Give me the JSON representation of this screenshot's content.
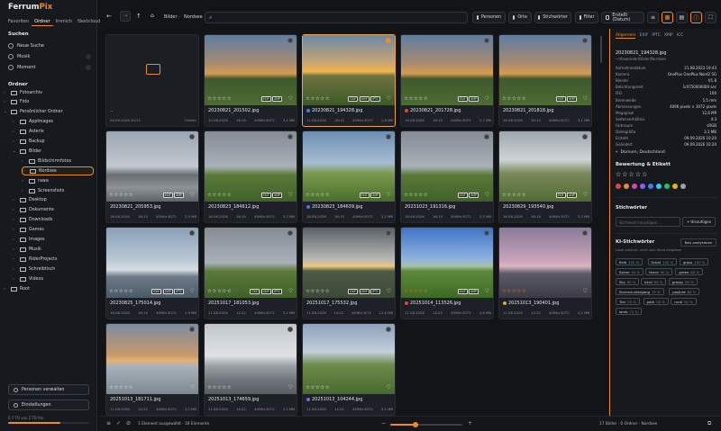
{
  "app": {
    "name_a": "Ferrum",
    "name_b": "Pix"
  },
  "left": {
    "tabs": [
      "Favoriten",
      "Ordner",
      "Immich",
      "Nextcloud"
    ],
    "search_title": "Suchen",
    "searches": [
      "Neue Suche",
      "Musik",
      "Moment"
    ],
    "folders_title": "Ordner",
    "tree": [
      {
        "label": "Fotoarchiv",
        "indent": 1,
        "expanded": false
      },
      {
        "label": "Foto",
        "indent": 1,
        "expanded": false
      },
      {
        "label": "Persönlicher Ordner",
        "indent": 1,
        "expanded": true
      },
      {
        "label": "AppImages",
        "indent": 2,
        "expanded": false
      },
      {
        "label": "Asterix",
        "indent": 2,
        "expanded": false
      },
      {
        "label": "Backup",
        "indent": 2,
        "expanded": false
      },
      {
        "label": "Bilder",
        "indent": 2,
        "expanded": true
      },
      {
        "label": "Bildschirmfotos",
        "indent": 3,
        "expanded": false
      },
      {
        "label": "Nordsee",
        "indent": 3,
        "expanded": false,
        "selected": true
      },
      {
        "label": "rawa",
        "indent": 3,
        "expanded": false
      },
      {
        "label": "Screenshots",
        "indent": 3,
        "expanded": false
      },
      {
        "label": "Desktop",
        "indent": 2,
        "expanded": false
      },
      {
        "label": "Dokumente",
        "indent": 2,
        "expanded": false
      },
      {
        "label": "Downloads",
        "indent": 2,
        "expanded": false
      },
      {
        "label": "Games",
        "indent": 2,
        "expanded": false
      },
      {
        "label": "Images",
        "indent": 2,
        "expanded": false
      },
      {
        "label": "Musik",
        "indent": 2,
        "expanded": false
      },
      {
        "label": "RiderProjects",
        "indent": 2,
        "expanded": false
      },
      {
        "label": "Schreibtisch",
        "indent": 2,
        "expanded": false
      },
      {
        "label": "Videos",
        "indent": 2,
        "expanded": false
      },
      {
        "label": "Root",
        "indent": 1,
        "expanded": false
      }
    ],
    "btn_persons": "Personen verwalten",
    "btn_settings": "Einstellungen",
    "version": "0.7 TB von 2 TB frei",
    "storage_fill": 0.64
  },
  "toolbar": {
    "crumbs": [
      "Bilder",
      "Nordsee"
    ],
    "search_placeholder": "",
    "btn_persons": "Personen",
    "btn_places": "Orte",
    "btn_keywords": "Stichwörter",
    "btn_filter": "Filter",
    "btn_sort": "Erstellt (Datum)"
  },
  "cards": [
    {
      "type": "folder",
      "name": "..",
      "date": "04.09.2026 10:22",
      "kind": "Ordner"
    },
    {
      "name": "20230821_201502.jpg",
      "date": "10.08.2026",
      "time": "16:15",
      "res": "4096×3072",
      "size": "3,1 MB",
      "colorDot": "",
      "thumb": "sunset-field",
      "badges": [
        "EXIF",
        "XMP"
      ]
    },
    {
      "name": "20230821_194328.jpg",
      "date": "11.08.2026",
      "time": "16:15",
      "res": "4096×3072",
      "size": "1,8 MB",
      "colorDot": "#4a7be0",
      "thumb": "sunset-gold",
      "badges": [
        "EXIF",
        "XMP",
        "IPTC"
      ],
      "selected": true
    },
    {
      "name": "20230821_201728.jpg",
      "date": "16.08.2026",
      "time": "16:15",
      "res": "4096×3072",
      "size": "2,7 MB",
      "colorDot": "#e0473b",
      "thumb": "sunset-field",
      "badges": [
        "EXIF",
        "XMP"
      ]
    },
    {
      "name": "20230821_201818.jpg",
      "date": "16.08.2026",
      "time": "16:15",
      "res": "4096×3072",
      "size": "3,1 MB",
      "colorDot": "",
      "thumb": "sunset-field",
      "badges": [
        "EXIF",
        "XMP"
      ]
    },
    {
      "name": "20230821_205953.jpg",
      "date": "16.08.2026",
      "time": "16:15",
      "res": "4096×3072",
      "size": "2,5 MB",
      "colorDot": "",
      "thumb": "beach-grey",
      "badges": [
        "EXIF",
        "XMP"
      ]
    },
    {
      "name": "20230823_184612.jpg",
      "date": "16.08.2026",
      "time": "16:15",
      "res": "4096×3072",
      "size": "3,2 MB",
      "colorDot": "",
      "thumb": "grey-field",
      "badges": [
        "EXIF",
        "XMP"
      ]
    },
    {
      "name": "20230823_184639.jpg",
      "date": "16.08.2026",
      "time": "16:15",
      "res": "4096×3072",
      "size": "3,2 MB",
      "colorDot": "#4a7be0",
      "thumb": "sky-field",
      "badges": [
        "EXIF",
        "XMP"
      ]
    },
    {
      "name": "20231023_191316.jpg",
      "date": "16.08.2026",
      "time": "16:15",
      "res": "4096×3072",
      "size": "2,5 MB",
      "colorDot": "",
      "thumb": "grey-field",
      "badges": [
        "EXIF",
        "XMP"
      ]
    },
    {
      "name": "20230829_193540.jpg",
      "date": "16.08.2026",
      "time": "16:15",
      "res": "4096×3072",
      "size": "3,2 MB",
      "colorDot": "",
      "thumb": "cloud-field",
      "badges": [
        "EXIF",
        "XMP"
      ]
    },
    {
      "name": "20230825_175014.jpg",
      "date": "16.08.2026",
      "time": "16:15",
      "res": "4096×3072",
      "size": "1,9 MB",
      "colorDot": "",
      "thumb": "harbor",
      "badges": [
        "EXIF",
        "XMP",
        "IPTC"
      ]
    },
    {
      "name": "20251017_181053.jpg",
      "date": "11.08.2026",
      "time": "14:22",
      "res": "4096×3072",
      "size": "3,2 MB",
      "colorDot": "",
      "thumb": "grey-field",
      "badges": [
        "EXIF",
        "XMP",
        "IPTC"
      ]
    },
    {
      "name": "20251017_175532.jpg",
      "date": "11.08.2026",
      "time": "14:22",
      "res": "4096×3072",
      "size": "12,6 MB",
      "colorDot": "",
      "thumb": "dramatic",
      "badges": [
        "EXIF",
        "XMP",
        "IPTC"
      ]
    },
    {
      "name": "20251014_113526.jpg",
      "date": "11.08.2026",
      "time": "14:22",
      "res": "4096×3072",
      "size": "4,6 MB",
      "colorDot": "#e0473b",
      "thumb": "rainbow",
      "badges": [
        "EXIF",
        "XMP"
      ],
      "orangeStars": true
    },
    {
      "name": "20251013_190401.jpg",
      "date": "11.08.2026",
      "time": "14:22",
      "res": "4096×3072",
      "size": "4,2 MB",
      "colorDot": "#e0a83b",
      "thumb": "lake",
      "badges": [],
      "orangeStars": true
    },
    {
      "name": "20251013_181711.jpg",
      "date": "11.08.2026",
      "time": "14:22",
      "res": "4096×3072",
      "size": "3,2 MB",
      "colorDot": "",
      "thumb": "warm-sky",
      "badges": []
    },
    {
      "name": "20251013_174659.jpg",
      "date": "11.08.2026",
      "time": "14:22",
      "res": "4096×3072",
      "size": "3,2 MB",
      "colorDot": "",
      "thumb": "beach-wide",
      "badges": []
    },
    {
      "name": "20251013_104244.jpg",
      "date": "11.08.2026",
      "time": "14:22",
      "res": "4096×3072",
      "size": "3,2 MB",
      "colorDot": "#6a6fe0",
      "thumb": "sheep",
      "badges": []
    }
  ],
  "right": {
    "tabs": [
      "Allgemein",
      "EXIF",
      "IPTC",
      "XMP",
      "ICC"
    ],
    "filename": "20230821_194328.jpg",
    "path": "~/Anwender/Bilder/Nordsee",
    "props": [
      [
        "Aufnahmedatum",
        "21.08.2023 19:43"
      ],
      [
        "Kamera",
        "OnePlus OnePlus Nord2 5G"
      ],
      [
        "Blende",
        "f/1.8"
      ],
      [
        "Belichtungszeit",
        "1/4750000000 sec"
      ],
      [
        "ISO",
        "100"
      ],
      [
        "Brennweite",
        "5.5 mm"
      ],
      [
        "Abmessungen",
        "4096 pixels × 3072 pixels"
      ],
      [
        "Megapixel",
        "12,6 MP"
      ],
      [
        "Seitenverhältnis",
        "4:3"
      ],
      [
        "Farbraum",
        "sRGB"
      ],
      [
        "Dateigröße",
        "3,1 MB"
      ],
      [
        "Erstellt",
        "09.09.2026 10:20"
      ],
      [
        "Geändert",
        "09.09.2026 10:20"
      ]
    ],
    "location": "Dornum, Deutschland",
    "rating_title": "Bewertung & Etikett",
    "label_colors": [
      "#e0473b",
      "#e08a3b",
      "#d946a8",
      "#8b5cf6",
      "#3b82f6",
      "#22d3ee",
      "#22c55e",
      "#eab308",
      "#9ca3af"
    ],
    "keywords_title": "Stichwörter",
    "keyword_placeholder": "Stichwort hinzufügen ...",
    "keyword_add": "+ Hinzufügen",
    "ai_title": "KI-Stichwörter",
    "ai_button": "Neu analysieren",
    "ai_note": "Lokal erkannt, nicht vom Hand vergeben",
    "ai_tags": [
      [
        "field",
        "100 %"
      ],
      [
        "Schaf",
        "100 %"
      ],
      [
        "grass",
        "100 %"
      ],
      [
        "Szene",
        "94 %"
      ],
      [
        "fence",
        "90 %"
      ],
      [
        "green",
        "80 %"
      ],
      [
        "Sky",
        "80 %"
      ],
      [
        "herd",
        "80 %"
      ],
      [
        "grassy",
        "80 %"
      ],
      [
        "Sonnenuntergang",
        "75 %"
      ],
      [
        "pasture",
        "60 %"
      ],
      [
        "Tier",
        "55 %"
      ],
      [
        "path",
        "50 %"
      ],
      [
        "rural",
        "50 %"
      ],
      [
        "lamb",
        "71 %"
      ]
    ]
  },
  "bottom": {
    "selection": "1 Element ausgewählt · 18 Elemente",
    "counts": "17 Bilder · 0 Ordner · Nordsee",
    "zoom": 0.35
  }
}
